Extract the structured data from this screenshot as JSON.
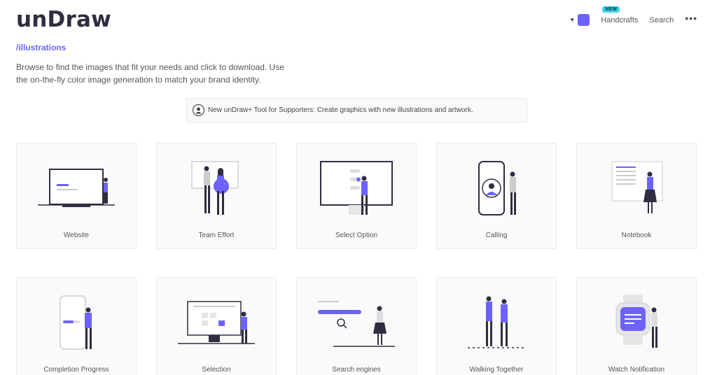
{
  "header": {
    "logo": "unDraw",
    "subnav": "/illustrations",
    "intro": "Browse to find the images that fit your needs and click to download. Use the on-the-fly color image generation to match your brand identity."
  },
  "topnav": {
    "badge": "NEW",
    "handcrafts": "Handcrafts",
    "search": "Search",
    "more": "•••",
    "accent_color": "#6c63ff"
  },
  "promo": {
    "text": "New unDraw+ Tool for Supporters: Create graphics with new illustrations and artwork.",
    "icon": "user-avatar-icon"
  },
  "cards": [
    {
      "label": "Website"
    },
    {
      "label": "Team Effort"
    },
    {
      "label": "Select Option"
    },
    {
      "label": "Calling"
    },
    {
      "label": "Notebook"
    },
    {
      "label": "Completion Progress"
    },
    {
      "label": "Selection"
    },
    {
      "label": "Search engines"
    },
    {
      "label": "Walking Together"
    },
    {
      "label": "Watch Notification"
    }
  ]
}
